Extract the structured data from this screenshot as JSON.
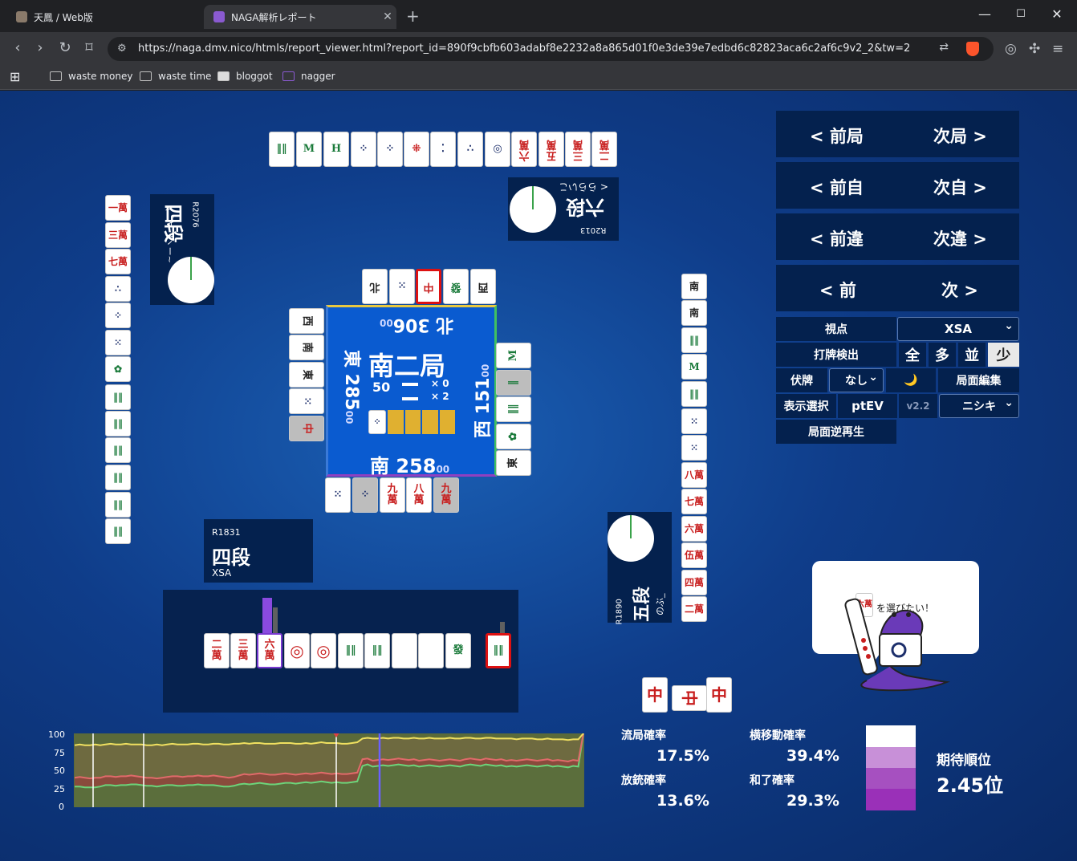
{
  "browser": {
    "tabs": [
      {
        "title": "天鳳 / Web版"
      },
      {
        "title": "NAGA解析レポート"
      }
    ],
    "url": "https://naga.dmv.nico/htmls/report_viewer.html?report_id=890f9cbfb603adabf8e2232a8a865d01f0e3de39e7edbd6c82823aca6c2af6c9v2_2&tw=2",
    "bookmarks": [
      "waste money",
      "waste time",
      "bloggot",
      "nagger"
    ]
  },
  "players": {
    "bottom": {
      "rating": "R1831",
      "rank": "四段",
      "name": "XSA"
    },
    "right": {
      "rating": "R1890",
      "rank": "五段",
      "name": "のぶ_"
    },
    "top": {
      "rating": "R2013",
      "rank": "六段",
      "name": "< ららいこ"
    },
    "left": {
      "rating": "R2076",
      "rank": "四段",
      "name": "( ´ ∀ `)ヽー~"
    }
  },
  "center": {
    "round": "南二局",
    "honba": "50",
    "riichi_x0": "× 0",
    "riichi_x2": "× 2",
    "south": "南 258",
    "south_sub": "00",
    "north": "北 306",
    "north_sub": "00",
    "east": "東 285",
    "east_sub": "00",
    "west": "西 151",
    "west_sub": "00"
  },
  "nav": {
    "prev_round": "< 前局",
    "next_round": "次局 >",
    "prev_self": "< 前自",
    "next_self": "次自 >",
    "prev_diff": "< 前違",
    "next_diff": "次違 >",
    "prev": "< 前",
    "next": "次 >"
  },
  "controls": {
    "viewpoint_label": "視点",
    "viewpoint_value": "XSA",
    "detect_label": "打牌検出",
    "detect_opts": [
      "全",
      "多",
      "並",
      "少"
    ],
    "fusei_label": "伏牌",
    "fusei_value": "なし",
    "moon": "🌙",
    "edit_label": "局面編集",
    "display_label": "表示選択",
    "ptev_label": "ptEV",
    "version": "v2.2",
    "model_value": "ニシキ",
    "reverse_label": "局面逆再生"
  },
  "bubble": {
    "tile": "六萬",
    "text": "を選びたい！"
  },
  "stats": {
    "ryukyoku_label": "流局確率",
    "ryukyoku_value": "17.5%",
    "yoko_label": "横移動確率",
    "yoko_value": "39.4%",
    "houju_label": "放銃確率",
    "houju_value": "13.6%",
    "hora_label": "和了確率",
    "hora_value": "29.3%",
    "rank_label": "期待順位",
    "rank_value": "2.45位"
  },
  "chart_data": {
    "type": "area",
    "ylim": [
      0,
      100
    ],
    "yticks": [
      "100",
      "75",
      "50",
      "25",
      "0"
    ],
    "series": [
      {
        "values": [
          28,
          28,
          27,
          27,
          27,
          28,
          30,
          30,
          29,
          30,
          30,
          31,
          31,
          30,
          29,
          29,
          28,
          29,
          30,
          30,
          29,
          29,
          30,
          30,
          31,
          30,
          30,
          30,
          29,
          28,
          28,
          29,
          31,
          32,
          31,
          32,
          33,
          32,
          31,
          31,
          32,
          33,
          33,
          32,
          33,
          34,
          33,
          34,
          35,
          34,
          33,
          34,
          33,
          33,
          34,
          35,
          56,
          58,
          55,
          56,
          57,
          56,
          57,
          58,
          57,
          56,
          57,
          55,
          56,
          57,
          56,
          55,
          56,
          57,
          56,
          55,
          57,
          58,
          57,
          56,
          58,
          57,
          56,
          57,
          55,
          56,
          55,
          56,
          57,
          56,
          55,
          56,
          57,
          55,
          56,
          55,
          54,
          56,
          55,
          100
        ]
      },
      {
        "values": [
          40,
          41,
          40,
          39,
          40,
          40,
          42,
          42,
          41,
          42,
          42,
          43,
          42,
          41,
          40,
          40,
          39,
          40,
          41,
          42,
          42,
          41,
          42,
          42,
          43,
          42,
          42,
          43,
          42,
          41,
          40,
          41,
          43,
          45,
          44,
          45,
          46,
          45,
          44,
          44,
          45,
          46,
          45,
          44,
          45,
          46,
          45,
          46,
          47,
          46,
          45,
          46,
          45,
          45,
          46,
          47,
          65,
          66,
          63,
          64,
          65,
          64,
          65,
          66,
          65,
          64,
          65,
          63,
          64,
          65,
          64,
          63,
          64,
          65,
          64,
          63,
          65,
          66,
          65,
          64,
          66,
          65,
          64,
          65,
          63,
          64,
          63,
          64,
          65,
          64,
          63,
          64,
          65,
          63,
          64,
          63,
          62,
          64,
          63,
          100
        ]
      },
      {
        "values": [
          84,
          85,
          84,
          84,
          85,
          84,
          85,
          86,
          85,
          85,
          86,
          85,
          85,
          85,
          84,
          84,
          85,
          84,
          85,
          86,
          85,
          85,
          85,
          86,
          86,
          85,
          85,
          86,
          86,
          85,
          85,
          86,
          86,
          87,
          86,
          87,
          87,
          86,
          86,
          86,
          87,
          87,
          87,
          86,
          86,
          87,
          86,
          87,
          88,
          87,
          87,
          87,
          86,
          86,
          87,
          88,
          93,
          94,
          93,
          93,
          94,
          93,
          94,
          94,
          93,
          93,
          94,
          93,
          93,
          94,
          93,
          93,
          93,
          94,
          93,
          93,
          94,
          94,
          93,
          93,
          94,
          94,
          93,
          93,
          93,
          93,
          92,
          93,
          93,
          93,
          92,
          92,
          93,
          92,
          92,
          92,
          91,
          92,
          92,
          100
        ]
      }
    ]
  }
}
